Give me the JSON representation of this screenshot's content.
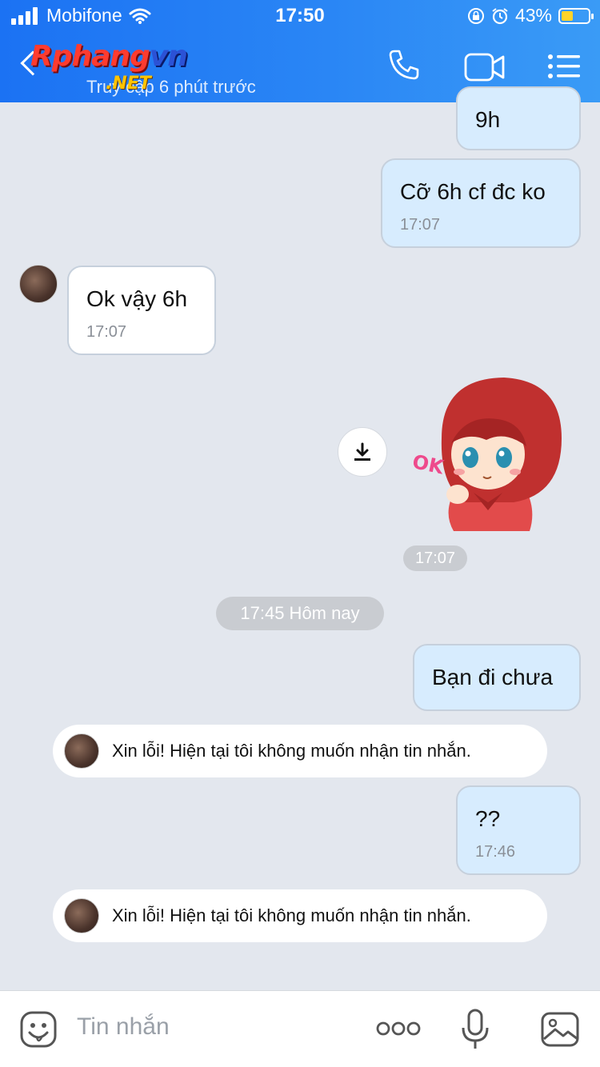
{
  "status_bar": {
    "carrier": "Mobifone",
    "time": "17:50",
    "battery": "43%"
  },
  "header": {
    "logo_main": "Rphang",
    "logo_suffix": "vn",
    "logo_net": ".NET",
    "subtitle": "Truy cập 6 phút trước"
  },
  "messages": [
    {
      "text": "9h"
    },
    {
      "text": "Cỡ 6h cf đc ko",
      "time": "17:07"
    },
    {
      "text": "Ok vậy 6h",
      "time": "17:07"
    },
    {
      "sticker_time": "17:07"
    },
    {
      "divider": "17:45 Hôm nay"
    },
    {
      "text": "Bạn đi chưa"
    },
    {
      "system": "Xin lỗi! Hiện tại tôi không muốn nhận tin nhắn."
    },
    {
      "text": "??",
      "time": "17:46"
    },
    {
      "system": "Xin lỗi! Hiện tại tôi không muốn nhận tin nhắn."
    }
  ],
  "sticker": {
    "label": "OK"
  },
  "input": {
    "placeholder": "Tin nhắn"
  },
  "colors": {
    "header_start": "#1b72f3",
    "header_end": "#3a9bf6",
    "outgoing_bubble": "#d7ecfe",
    "chat_bg": "#e3e7ee"
  },
  "icons": [
    "signal-icon",
    "wifi-icon",
    "lock-rotation-icon",
    "alarm-icon",
    "battery-icon",
    "back-icon",
    "phone-icon",
    "video-call-icon",
    "menu-icon",
    "download-icon",
    "emoji-icon",
    "more-icon",
    "mic-icon",
    "image-icon"
  ]
}
